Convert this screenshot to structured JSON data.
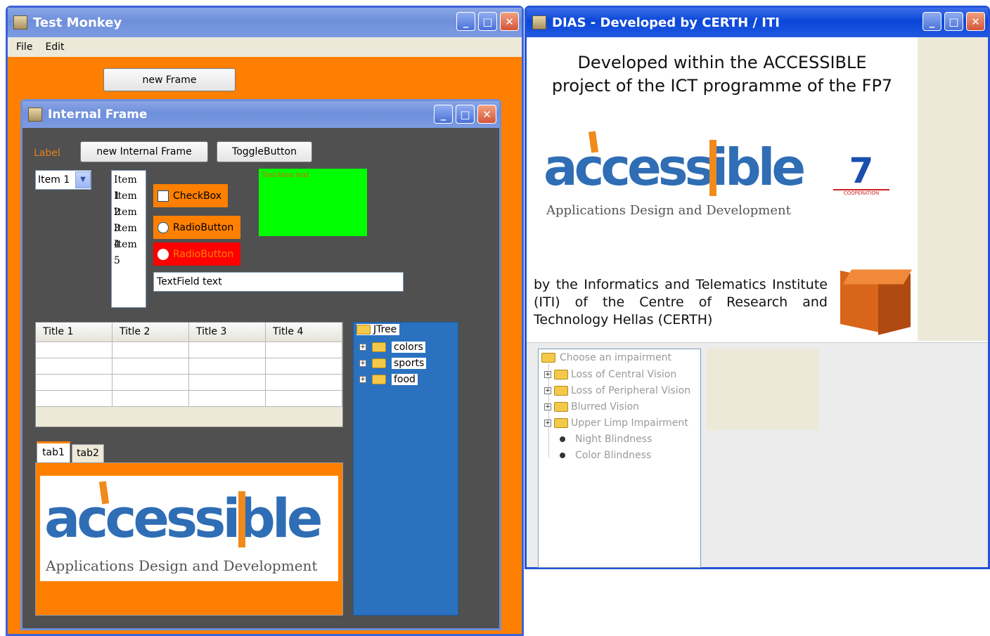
{
  "test_monkey": {
    "title": "Test Monkey",
    "menu": [
      "File",
      "Edit"
    ],
    "new_frame_button": "new Frame",
    "internal_frame": {
      "title": "Internal Frame",
      "label": "Label",
      "new_internal_frame_button": "new Internal Frame",
      "toggle_button": "ToggleButton",
      "combo_value": "Item 1",
      "list_items": [
        "Item 1",
        "Item 2",
        "Item 3",
        "Item 4",
        "Item 5"
      ],
      "checkbox_label": "CheckBox",
      "radio1_label": "RadioButton",
      "radio2_label": "RadioButton",
      "textarea_text": "TextArea text",
      "textfield_text": "TextField text",
      "table_headers": [
        "Title 1",
        "Title 2",
        "Title 3",
        "Title 4"
      ],
      "tree": {
        "root": "JTree",
        "children": [
          "colors",
          "sports",
          "food"
        ]
      },
      "tabs": [
        "tab1",
        "tab2"
      ],
      "logo_word": "accessible",
      "logo_tagline": "Applications Design and Development"
    }
  },
  "dias": {
    "title": "DIAS - Developed by CERTH / ITI",
    "heading_line1": "Developed within the ACCESSIBLE",
    "heading_line2": "project of the ICT programme of the FP7",
    "logo_word": "accessible",
    "logo_tagline": "Applications Design and Development",
    "fp7_number": "7",
    "fp7_label": "COOPERATION",
    "by_text": "by the Informatics and Telematics Institute (ITI) of the Centre of Research and Technology Hellas (CERTH)",
    "tree": {
      "root": "Choose an impairment",
      "folders": [
        "Loss of Central Vision",
        "Loss of Peripheral Vision",
        "Blurred Vision",
        "Upper Limp Impairment"
      ],
      "leaves": [
        "Night Blindness",
        "Color Blindness"
      ]
    }
  },
  "colors": {
    "orange": "#ff8000",
    "dark_gray": "#505050",
    "tree_blue": "#2a72c0",
    "green": "#00ff00",
    "red": "#ff0000"
  }
}
